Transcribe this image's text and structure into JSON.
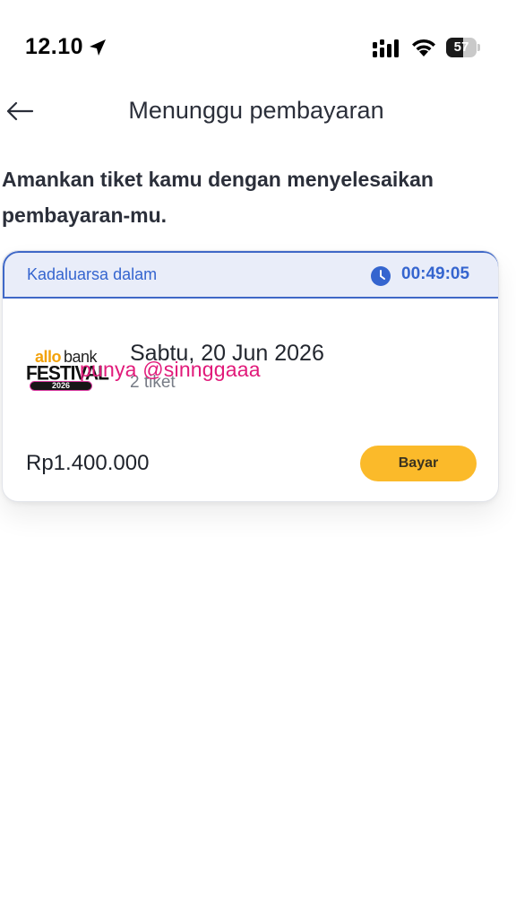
{
  "status_bar": {
    "time": "12.10",
    "battery": 57,
    "battery_label": "57"
  },
  "header": {
    "title": "Menunggu pembayaran",
    "back_icon": "arrow-left-icon"
  },
  "intro_text": "Amankan tiket kamu dengan menyelesaikan pembayaran-mu.",
  "order": {
    "expiry_label": "Kadaluarsa dalam",
    "expiry_timer": "00:49:05",
    "logo": {
      "allo": "allo",
      "bank": "bank",
      "festival": "FESTIVAL",
      "year": "2026"
    },
    "date": "Sabtu, 20 Jun 2026",
    "tickets": "2 tiket",
    "watermark": "punya @sinnggaaa",
    "price": "Rp1.400.000",
    "pay_label": "Bayar"
  },
  "colors": {
    "accent_blue": "#3565cf",
    "expiry_bg": "#e9edf9",
    "pay_button": "#fbba2a",
    "watermark": "#e11a7a"
  }
}
